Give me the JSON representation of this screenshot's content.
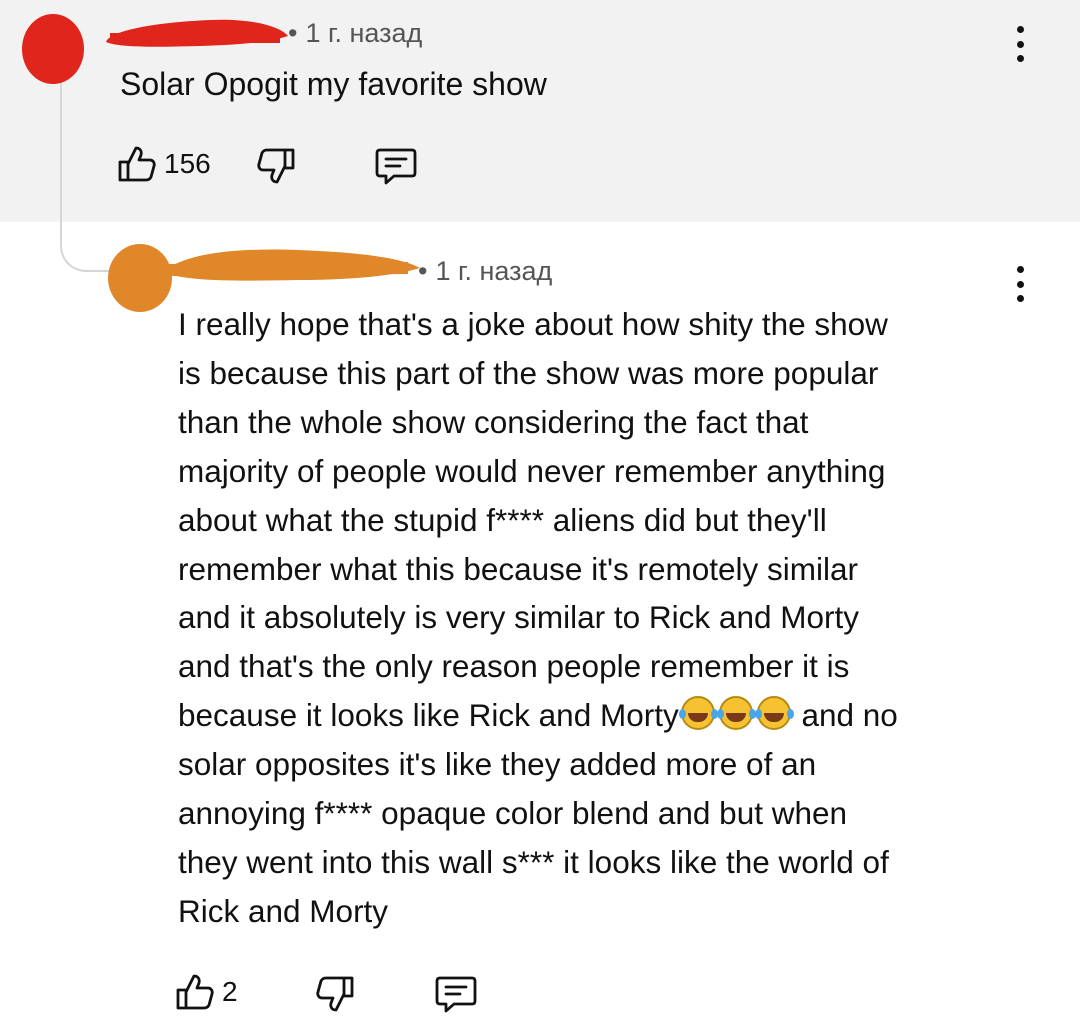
{
  "parent_comment": {
    "meta": "1 г. назад",
    "text": "Solar Opogit my favorite show",
    "likes": "156",
    "colors": {
      "avatar": "#e0261c",
      "name_redaction": "#e0261c",
      "background": "#f2f2f2"
    }
  },
  "reply_comment": {
    "meta": "1 г. назад",
    "lines": [
      "I really hope that's a joke about how shity the show",
      "is because this part of the show was more popular",
      "than the whole show considering the fact that",
      "majority of people would never remember anything",
      "about what the stupid f**** aliens did but they'll",
      "remember what this because it's remotely similar",
      "and it absolutely is very similar to Rick and Morty",
      "and that's the only reason people remember it is",
      "because it looks like Rick and Morty",
      "and no",
      "solar opposites it's like they added more of an",
      "annoying f**** opaque color blend and but when",
      "they went into this wall s*** it looks like the world of",
      "Rick and Morty"
    ],
    "emoji": [
      "😂",
      "😂",
      "😂"
    ],
    "likes": "2",
    "colors": {
      "avatar": "#e0872a",
      "name_redaction": "#e0872a"
    }
  },
  "icons": {
    "like": "thumbs-up-icon",
    "dislike": "thumbs-down-icon",
    "reply": "comment-icon",
    "menu": "more-vert-icon"
  }
}
